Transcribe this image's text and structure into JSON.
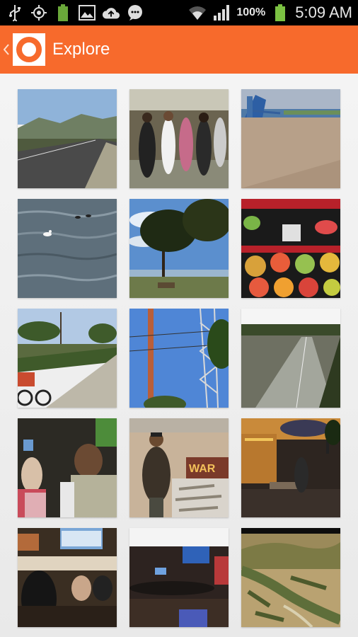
{
  "status_bar": {
    "icons_left": [
      "usb-icon",
      "gps-icon",
      "battery-saver-icon",
      "gallery-icon",
      "cloud-upload-icon",
      "chat-icon"
    ],
    "icons_right": [
      "wifi-icon",
      "signal-icon",
      "battery-icon"
    ],
    "battery_percent": "100%",
    "time": "5:09 AM"
  },
  "action_bar": {
    "title": "Explore",
    "logo_icon": "ring-logo-icon",
    "accent_color": "#f76a2c"
  },
  "photos": [
    {
      "subject": "road-with-hills"
    },
    {
      "subject": "crowd-of-people"
    },
    {
      "subject": "beach-with-waterslides"
    },
    {
      "subject": "water-with-swan"
    },
    {
      "subject": "tree-by-lake"
    },
    {
      "subject": "fruit-cups-display"
    },
    {
      "subject": "bike-path-with-cyclist"
    },
    {
      "subject": "power-pole-and-tower"
    },
    {
      "subject": "paved-trail"
    },
    {
      "subject": "bar-patrons"
    },
    {
      "subject": "man-at-art-booth"
    },
    {
      "subject": "patio-at-dusk"
    },
    {
      "subject": "sports-bar-crowd"
    },
    {
      "subject": "dark-bar-interior"
    },
    {
      "subject": "hillside-landscape"
    }
  ]
}
